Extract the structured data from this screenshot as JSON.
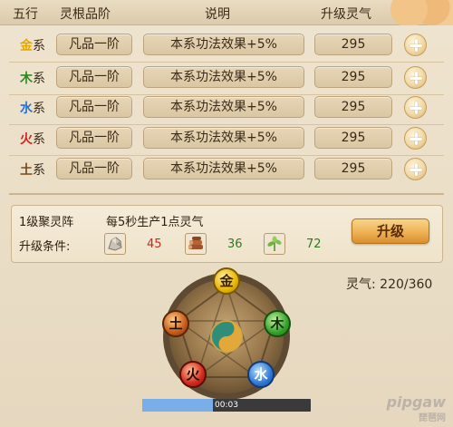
{
  "header": {
    "col_element": "五行",
    "col_grade": "灵根品阶",
    "col_desc": "说明",
    "col_cost": "升级灵气"
  },
  "rows": [
    {
      "name": "金",
      "suffix": "系",
      "color": "#e6a800",
      "grade": "凡品一阶",
      "desc": "本系功法效果+5%",
      "cost": "295"
    },
    {
      "name": "木",
      "suffix": "系",
      "color": "#2e8a1d",
      "grade": "凡品一阶",
      "desc": "本系功法效果+5%",
      "cost": "295"
    },
    {
      "name": "水",
      "suffix": "系",
      "color": "#2a6fd6",
      "grade": "凡品一阶",
      "desc": "本系功法效果+5%",
      "cost": "295"
    },
    {
      "name": "火",
      "suffix": "系",
      "color": "#d4231a",
      "grade": "凡品一阶",
      "desc": "本系功法效果+5%",
      "cost": "295"
    },
    {
      "name": "土",
      "suffix": "系",
      "color": "#7a4a1c",
      "grade": "凡品一阶",
      "desc": "本系功法效果+5%",
      "cost": "295"
    }
  ],
  "array_info": {
    "level": "1级聚灵阵",
    "production": "每5秒生产1点灵气",
    "requirement_label": "升级条件:",
    "resources": [
      {
        "icon": "stone-ore-icon",
        "value": "45",
        "color": "#c62b1c"
      },
      {
        "icon": "wood-logs-icon",
        "value": "36",
        "color": "#2f7a21"
      },
      {
        "icon": "herb-plant-icon",
        "value": "72",
        "color": "#2f7a21"
      }
    ],
    "upgrade_label": "升级"
  },
  "qi": {
    "label": "灵气:",
    "value": "220/360"
  },
  "wheel": {
    "nodes": [
      {
        "char": "金",
        "color": "#e9b400"
      },
      {
        "char": "木",
        "color": "#33a22a"
      },
      {
        "char": "水",
        "color": "#2d78d8"
      },
      {
        "char": "火",
        "color": "#d0281b"
      },
      {
        "char": "土",
        "color": "#c45a19"
      }
    ]
  },
  "video": {
    "time": "00:03",
    "progress": 0.42
  },
  "watermark": {
    "brand": "pipgaw",
    "sub": "琵琶网"
  }
}
